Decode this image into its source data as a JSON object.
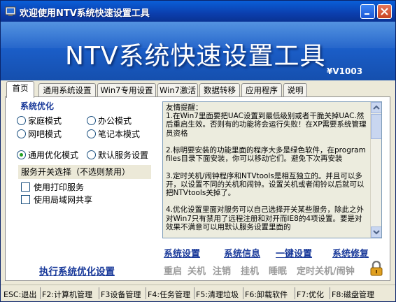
{
  "window": {
    "title": "欢迎使用NTV系统快速设置工具"
  },
  "banner": {
    "title": "NTV系统快速设置工具",
    "version": "V1003"
  },
  "tabs": [
    {
      "label": "首页"
    },
    {
      "label": "通用系统设置"
    },
    {
      "label": "Win7专用设置"
    },
    {
      "label": "Win7激活"
    },
    {
      "label": "数据转移"
    },
    {
      "label": "应用程序"
    },
    {
      "label": "说明"
    }
  ],
  "active_tab": "首页",
  "optimize": {
    "group_title": "系统优化",
    "modes": [
      {
        "label": "家庭模式",
        "selected": false
      },
      {
        "label": "办公模式",
        "selected": false
      },
      {
        "label": "网吧模式",
        "selected": false
      },
      {
        "label": "笔记本模式",
        "selected": false
      },
      {
        "label": "通用优化模式",
        "selected": true
      },
      {
        "label": "默认服务设置",
        "selected": false
      }
    ],
    "service_title": "服务开关选择（不选则禁用）",
    "services": [
      {
        "label": "使用打印服务",
        "checked": false
      },
      {
        "label": "使用局域网共享",
        "checked": false
      }
    ],
    "run_link": "执行系统优化设置"
  },
  "notes": {
    "text": "友情提醒：\n1.在Win7里面要把UAC设置到最低级别或者干脆关掉UAC.然后重启生效。否则有的功能将会运行失败！在XP需要系统管理员资格\n\n2.标明要安装的功能里面的程序大多是绿色软件，在program files目录下面安装，你可以移动它们。避免下次再安装\n\n3.定时关机/闹钟程序和NTVtools是相互独立的。并且可以多开，以设置不同的关机和闹钟。设置关机或者闹铃以后就可以把NTVtools关掉了。\n\n4.优化设置里面对服务可以自己选择开关某些服务，除此之外对Win7只有禁用了远程注册和对开而IE8的4项设置。要是对效果不满意可以用默认服务设置里面的"
  },
  "actions": [
    {
      "label": "系统设置"
    },
    {
      "label": "系统信息"
    },
    {
      "label": "一键设置"
    },
    {
      "label": "系统修复"
    }
  ],
  "power": [
    {
      "label": "重启"
    },
    {
      "label": "关机"
    },
    {
      "label": "注销"
    },
    {
      "label": "挂机"
    },
    {
      "label": "睡眠"
    },
    {
      "label": "定时关机/闹钟"
    }
  ],
  "statusbar": [
    {
      "label": "ESC:退出"
    },
    {
      "label": "F2:计算机管理"
    },
    {
      "label": "F3设备管理"
    },
    {
      "label": "F4:任务管理"
    },
    {
      "label": "F5:清理垃圾"
    },
    {
      "label": "F6:卸载软件"
    },
    {
      "label": "F7:优化"
    },
    {
      "label": "F8:磁盘管理"
    }
  ],
  "colors": {
    "title_bar": "#0b3fae",
    "banner": "#1b5ec8",
    "link_blue": "#1a3a9a",
    "disabled_gray": "#9a9a9a"
  }
}
